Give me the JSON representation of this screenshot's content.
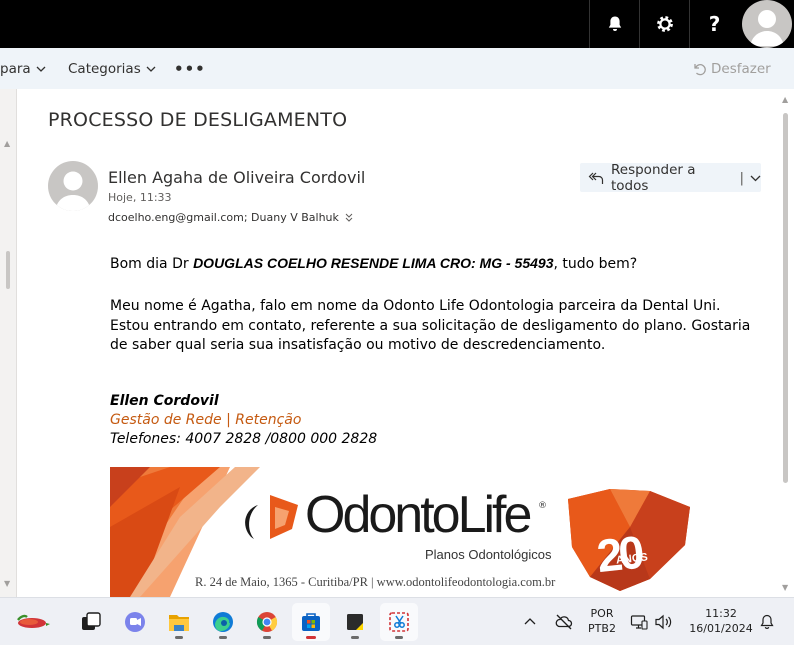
{
  "topbar": {
    "help_label": "?",
    "icons": [
      "bell-icon",
      "gear-icon",
      "help-icon",
      "user-avatar"
    ]
  },
  "toolbar": {
    "move_label": "para",
    "categories_label": "Categorias",
    "more_label": "•••",
    "undo_label": "Desfazer"
  },
  "message": {
    "subject": "PROCESSO DE DESLIGAMENTO",
    "sender": "Ellen Agaha de Oliveira Cordovil",
    "date": "Hoje, 11:33",
    "recipients": "dcoelho.eng@gmail.com; Duany V Balhuk",
    "reply_all_label": "Responder a todos",
    "greeting_pre": "Bom dia Dr ",
    "greeting_name": "DOUGLAS COELHO RESENDE LIMA CRO: MG - 55493",
    "greeting_post": ", tudo bem?",
    "paragraph": "Meu nome é Agatha, falo em nome da Odonto Life Odontologia parceira da Dental Uni. Estou entrando em contato, referente a sua solicitação de desligamento do plano. Gostaria de saber qual seria sua insatisfação ou motivo de descredenciamento.",
    "signature": {
      "name": "Ellen Cordovil",
      "role": "Gestão de Rede | Retenção",
      "phones": "Telefones: 4007 2828 /0800 000 2828"
    }
  },
  "banner": {
    "brand_odonto": "Odonto",
    "brand_life": "Life",
    "registered": "®",
    "subtitle": "Planos Odontológicos",
    "address": "R. 24 de Maio, 1365 - Curitiba/PR  |  www.odontolifeodontologia.com.br",
    "years": "20",
    "years_label": "ANOS",
    "colors": {
      "orange": "#e8591a",
      "red": "#c8401c",
      "dark": "#1a1a1a"
    }
  },
  "taskbar": {
    "apps": [
      "weather-icon",
      "task-view-icon",
      "teams-icon",
      "file-explorer-icon",
      "edge-icon",
      "chrome-icon",
      "store-icon",
      "sticky-notes-icon",
      "snipping-tool-icon"
    ],
    "language": "POR",
    "layout": "PTB2",
    "time": "11:32",
    "date": "16/01/2024"
  },
  "colors": {
    "accent": "#0078d4",
    "toolbar_bg": "#eff4f9",
    "signature_role": "#c55a11"
  }
}
